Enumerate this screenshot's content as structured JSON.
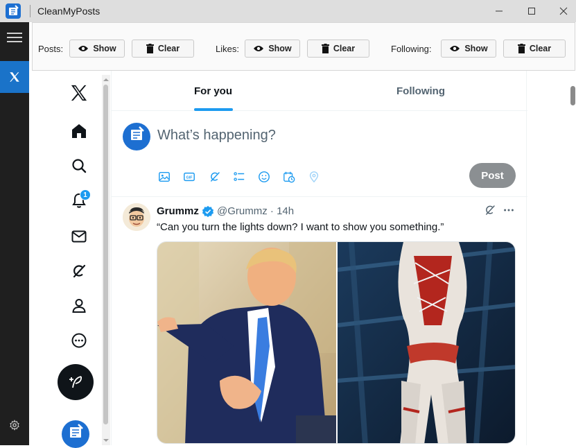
{
  "window": {
    "title": "CleanMyPosts",
    "controls": [
      "minimize",
      "maximize",
      "close"
    ]
  },
  "left_rail": {
    "items": [
      "hamburger-menu",
      "x-tab",
      "settings"
    ]
  },
  "toolbar": {
    "groups": [
      {
        "label": "Posts:",
        "show_label": "Show",
        "clear_label": "Clear"
      },
      {
        "label": "Likes:",
        "show_label": "Show",
        "clear_label": "Clear"
      },
      {
        "label": "Following:",
        "show_label": "Show",
        "clear_label": "Clear"
      }
    ]
  },
  "x_nav": {
    "items": [
      "x-logo",
      "home",
      "explore",
      "notifications",
      "messages",
      "grok",
      "profile",
      "more"
    ],
    "notification_count": "1",
    "avatar_label": "CleanMyPosts"
  },
  "feed": {
    "tabs": [
      {
        "label": "For you",
        "active": true
      },
      {
        "label": "Following",
        "active": false
      }
    ],
    "composer": {
      "placeholder": "What’s happening?",
      "post_label": "Post",
      "avatar_label": "CleanMyPosts",
      "tools": [
        "media",
        "gif",
        "grok",
        "poll",
        "emoji",
        "schedule",
        "location"
      ]
    },
    "tweet": {
      "name": "Grummz",
      "verified": true,
      "handle": "@Grummz",
      "time": "14h",
      "text": "“Can you turn the lights down? I want to show you something.”"
    }
  },
  "colors": {
    "accent": "#1d9bf0",
    "rail_selected": "#1a73c9",
    "post_button_disabled": "#8b8f92",
    "rail_background": "#1f1f1f"
  }
}
